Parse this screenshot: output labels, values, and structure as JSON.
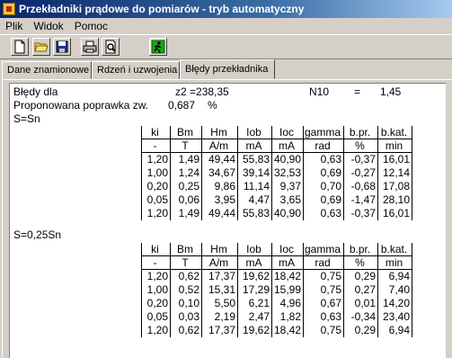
{
  "window": {
    "title": "Przekładniki prądowe do pomiarów - tryb automatyczny"
  },
  "menu": [
    "Plik",
    "Widok",
    "Pomoc"
  ],
  "toolbar": {
    "icons": [
      "new-file-icon",
      "open-folder-icon",
      "save-icon",
      "print-icon",
      "print-preview-icon",
      "exit-icon"
    ]
  },
  "tabs": [
    {
      "label": "Dane znamionowe",
      "active": false
    },
    {
      "label": "Rdzeń i uzwojenia",
      "active": false
    },
    {
      "label": "Błędy przekładnika",
      "active": true
    }
  ],
  "results": {
    "errors_label": "Błędy  dla",
    "z2_text": "z2 =238,35",
    "n10_label": "N10",
    "n10_eq": "=",
    "n10_value": "1,45",
    "correction_label": "Proponowana poprawka zw.",
    "correction_value": "0,687",
    "correction_unit": "%",
    "columns": [
      "ki",
      "Bm",
      "Hm",
      "Iob",
      "Ioc",
      "gamma",
      "b.pr.",
      "b.kat."
    ],
    "units": [
      "-",
      "T",
      "A/m",
      "mA",
      "mA",
      "rad",
      "%",
      "min"
    ],
    "section1": {
      "label": "S=Sn",
      "rows": [
        [
          "1,20",
          "1,49",
          "49,44",
          "55,83",
          "40,90",
          "0,63",
          "-0,37",
          "16,01"
        ],
        [
          "1,00",
          "1,24",
          "34,67",
          "39,14",
          "32,53",
          "0,69",
          "-0,27",
          "12,14"
        ],
        [
          "0,20",
          "0,25",
          "9,86",
          "11,14",
          "9,37",
          "0,70",
          "-0,68",
          "17,08"
        ],
        [
          "0,05",
          "0,06",
          "3,95",
          "4,47",
          "3,65",
          "0,69",
          "-1,47",
          "28,10"
        ],
        [
          "1,20",
          "1,49",
          "49,44",
          "55,83",
          "40,90",
          "0,63",
          "-0,37",
          "16,01"
        ]
      ]
    },
    "section2": {
      "label": "S=0,25Sn",
      "rows": [
        [
          "1,20",
          "0,62",
          "17,37",
          "19,62",
          "18,42",
          "0,75",
          "0,29",
          "6,94"
        ],
        [
          "1,00",
          "0,52",
          "15,31",
          "17,29",
          "15,99",
          "0,75",
          "0,27",
          "7,40"
        ],
        [
          "0,20",
          "0,10",
          "5,50",
          "6,21",
          "4,96",
          "0,67",
          "0,01",
          "14,20"
        ],
        [
          "0,05",
          "0,03",
          "2,19",
          "2,47",
          "1,82",
          "0,63",
          "-0,34",
          "23,40"
        ],
        [
          "1,20",
          "0,62",
          "17,37",
          "19,62",
          "18,42",
          "0,75",
          "0,29",
          "6,94"
        ]
      ]
    }
  }
}
